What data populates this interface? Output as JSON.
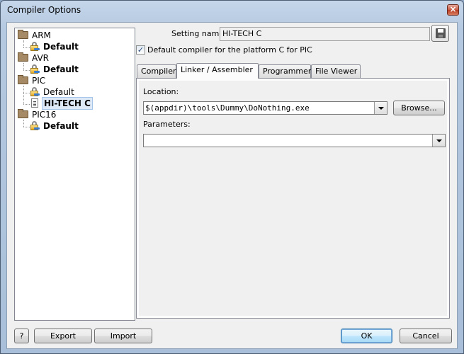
{
  "window": {
    "title": "Compiler Options",
    "close_label": "×"
  },
  "tree": {
    "nodes": [
      {
        "label": "ARM",
        "type": "folder"
      },
      {
        "label": "Default",
        "type": "locked"
      },
      {
        "label": "AVR",
        "type": "folder"
      },
      {
        "label": "Default",
        "type": "locked"
      },
      {
        "label": "PIC",
        "type": "folder"
      },
      {
        "label": "Default",
        "type": "locked"
      },
      {
        "label": "HI-TECH C",
        "type": "document",
        "selected": true
      },
      {
        "label": "PIC16",
        "type": "folder"
      },
      {
        "label": "Default",
        "type": "locked"
      }
    ]
  },
  "settings": {
    "name_label": "Setting name:",
    "name_value": "HI-TECH C",
    "default_checkbox_label": "Default compiler for the platform C for PIC",
    "default_checked": true,
    "checkmark": "✓"
  },
  "tabs": [
    {
      "label": "Compiler"
    },
    {
      "label": "Linker / Assembler",
      "active": true
    },
    {
      "label": "Programmer"
    },
    {
      "label": "File Viewer"
    }
  ],
  "linker": {
    "location_label": "Location:",
    "location_value": "$(appdir)\\tools\\Dummy\\DoNothing.exe",
    "browse_label": "Browse...",
    "parameters_label": "Parameters:",
    "parameters_value": ""
  },
  "footer": {
    "help_label": "?",
    "export_label": "Export",
    "import_label": "Import",
    "ok_label": "OK",
    "cancel_label": "Cancel"
  }
}
